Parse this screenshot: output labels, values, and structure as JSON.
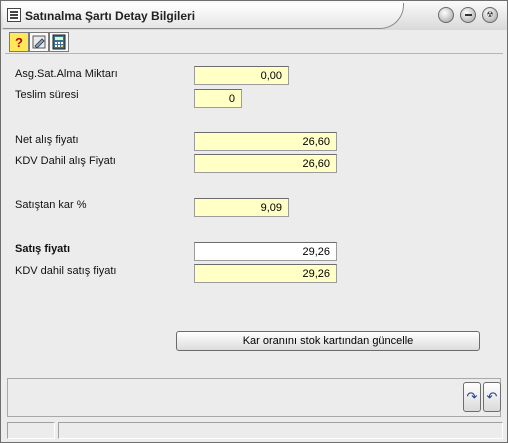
{
  "window": {
    "title": "Satınalma Şartı Detay Bilgileri",
    "buttons": {
      "restore_icon": "circle-icon",
      "minimize_icon": "minimize-icon",
      "close_icon": "radiation-icon"
    }
  },
  "toolbar": {
    "help_label": "?",
    "tools": [
      "help-icon",
      "edit-pencil-icon",
      "calculator-icon"
    ]
  },
  "form": {
    "min_purchase_qty": {
      "label": "Asg.Sat.Alma Miktarı",
      "value": "0,00"
    },
    "delivery_time": {
      "label": "Teslim süresi",
      "value": "0"
    },
    "net_price": {
      "label": "Net alış fiyatı",
      "value": "26,60"
    },
    "vat_incl_price": {
      "label": "KDV Dahil alış Fiyatı",
      "value": "26,60"
    },
    "profit_pct": {
      "label": "Satıştan kar %",
      "value": "9,09"
    },
    "sale_price": {
      "label": "Satış fiyatı",
      "value": "29,26"
    },
    "vat_incl_sale_price": {
      "label": "KDV dahil satış fiyatı",
      "value": "29,26"
    }
  },
  "actions": {
    "update_margin": "Kar oranını stok kartından güncelle"
  },
  "nav": {
    "redo_icon": "redo-icon",
    "undo_icon": "undo-icon"
  },
  "colors": {
    "input_highlight": "#ffffc6",
    "nav_icon": "#1c3d8f"
  }
}
